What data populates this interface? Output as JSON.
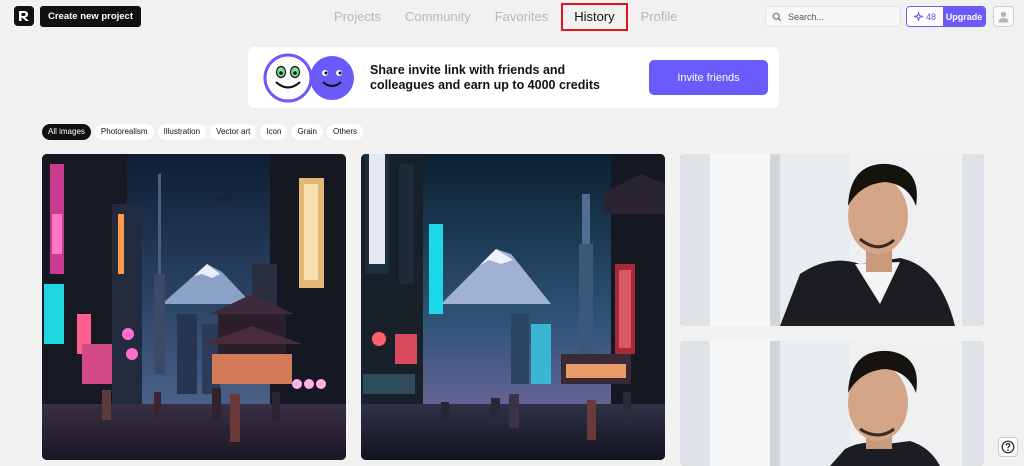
{
  "header": {
    "create_label": "Create new project",
    "nav": [
      {
        "label": "Projects"
      },
      {
        "label": "Community"
      },
      {
        "label": "Favorites"
      },
      {
        "label": "History",
        "active": true
      },
      {
        "label": "Profile"
      }
    ],
    "search_placeholder": "Search...",
    "credits": "48",
    "upgrade_label": "Upgrade"
  },
  "banner": {
    "text": "Share invite link with friends and colleagues and earn up to 4000 credits",
    "button_label": "Invite friends"
  },
  "filters": [
    {
      "label": "All images",
      "active": true
    },
    {
      "label": "Photorealism"
    },
    {
      "label": "Illustration"
    },
    {
      "label": "Vector art"
    },
    {
      "label": "Icon"
    },
    {
      "label": "Grain"
    },
    {
      "label": "Others"
    }
  ],
  "gallery": [
    {
      "subject": "neon Tokyo street at night with Mount Fuji"
    },
    {
      "subject": "neon Tokyo street at night with Mount Fuji and tower"
    },
    {
      "subject": "portrait of man in black jacket"
    },
    {
      "subject": "portrait of man in black jacket"
    }
  ],
  "colors": {
    "accent": "#6a5af9",
    "active_outline": "#e0161e",
    "background": "#f1f1f1"
  }
}
